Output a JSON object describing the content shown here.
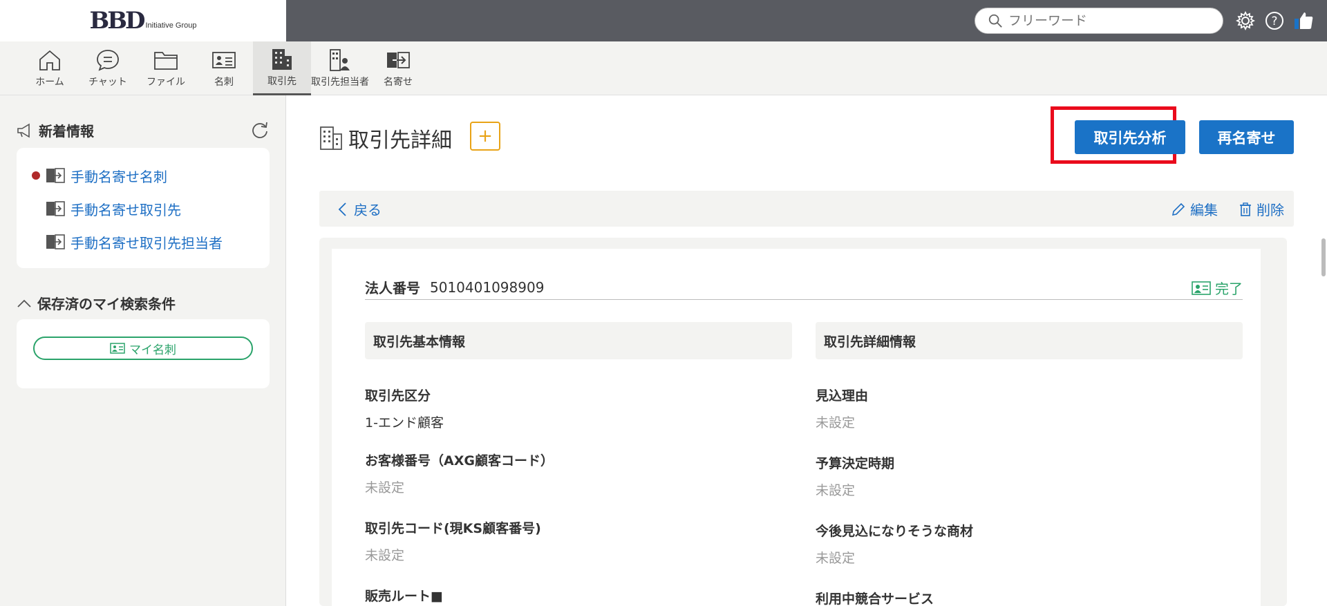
{
  "header": {
    "logo_main": "BBD",
    "logo_sub": "Initiative Group",
    "search_placeholder": "フリーワード",
    "icons": [
      "gear-icon",
      "help-icon",
      "thumbs-up-icon"
    ]
  },
  "nav": {
    "items": [
      {
        "label": "ホーム",
        "icon": "home-icon"
      },
      {
        "label": "チャット",
        "icon": "chat-icon"
      },
      {
        "label": "ファイル",
        "icon": "folder-icon"
      },
      {
        "label": "名刺",
        "icon": "business-card-icon"
      },
      {
        "label": "取引先",
        "icon": "building-icon",
        "active": true
      },
      {
        "label": "取引先担当者",
        "icon": "building-person-icon"
      },
      {
        "label": "名寄せ",
        "icon": "merge-icon"
      }
    ]
  },
  "sidebar": {
    "news_title": "新着情報",
    "news_items": [
      {
        "label": "手動名寄せ名刺",
        "unread": true
      },
      {
        "label": "手動名寄せ取引先",
        "unread": false
      },
      {
        "label": "手動名寄せ取引先担当者",
        "unread": false
      }
    ],
    "saved_title": "保存済のマイ検索条件",
    "mycard_label": "マイ名刺"
  },
  "main": {
    "title": "取引先詳細",
    "plus_label": "+",
    "analyze_label": "取引先分析",
    "rename_label": "再名寄せ",
    "back_label": "戻る",
    "edit_label": "編集",
    "delete_label": "削除",
    "corp_number_label": "法人番号",
    "corp_number": "5010401098909",
    "complete_label": "完了",
    "basic_section": "取引先基本情報",
    "detail_section": "取引先詳細情報",
    "basic_fields": [
      {
        "label": "取引先区分",
        "value": "1-エンド顧客",
        "unset": false
      },
      {
        "label": "お客様番号（AXG顧客コード）",
        "value": "未設定",
        "unset": true
      },
      {
        "label": "取引先コード(現KS顧客番号)",
        "value": "未設定",
        "unset": true
      },
      {
        "label": "販売ルート■",
        "value": "",
        "unset": true
      }
    ],
    "detail_fields": [
      {
        "label": "見込理由",
        "value": "未設定",
        "unset": true
      },
      {
        "label": "予算決定時期",
        "value": "未設定",
        "unset": true
      },
      {
        "label": "今後見込になりそうな商材",
        "value": "未設定",
        "unset": true
      },
      {
        "label": "利用中競合サービス",
        "value": "",
        "unset": true
      }
    ]
  },
  "colors": {
    "topbar": "#595b61",
    "accent_blue": "#1a73c7",
    "link_blue": "#1e6fc4",
    "highlight_red": "#ea0b1c",
    "green": "#2aa36a",
    "orange": "#e8a317"
  }
}
